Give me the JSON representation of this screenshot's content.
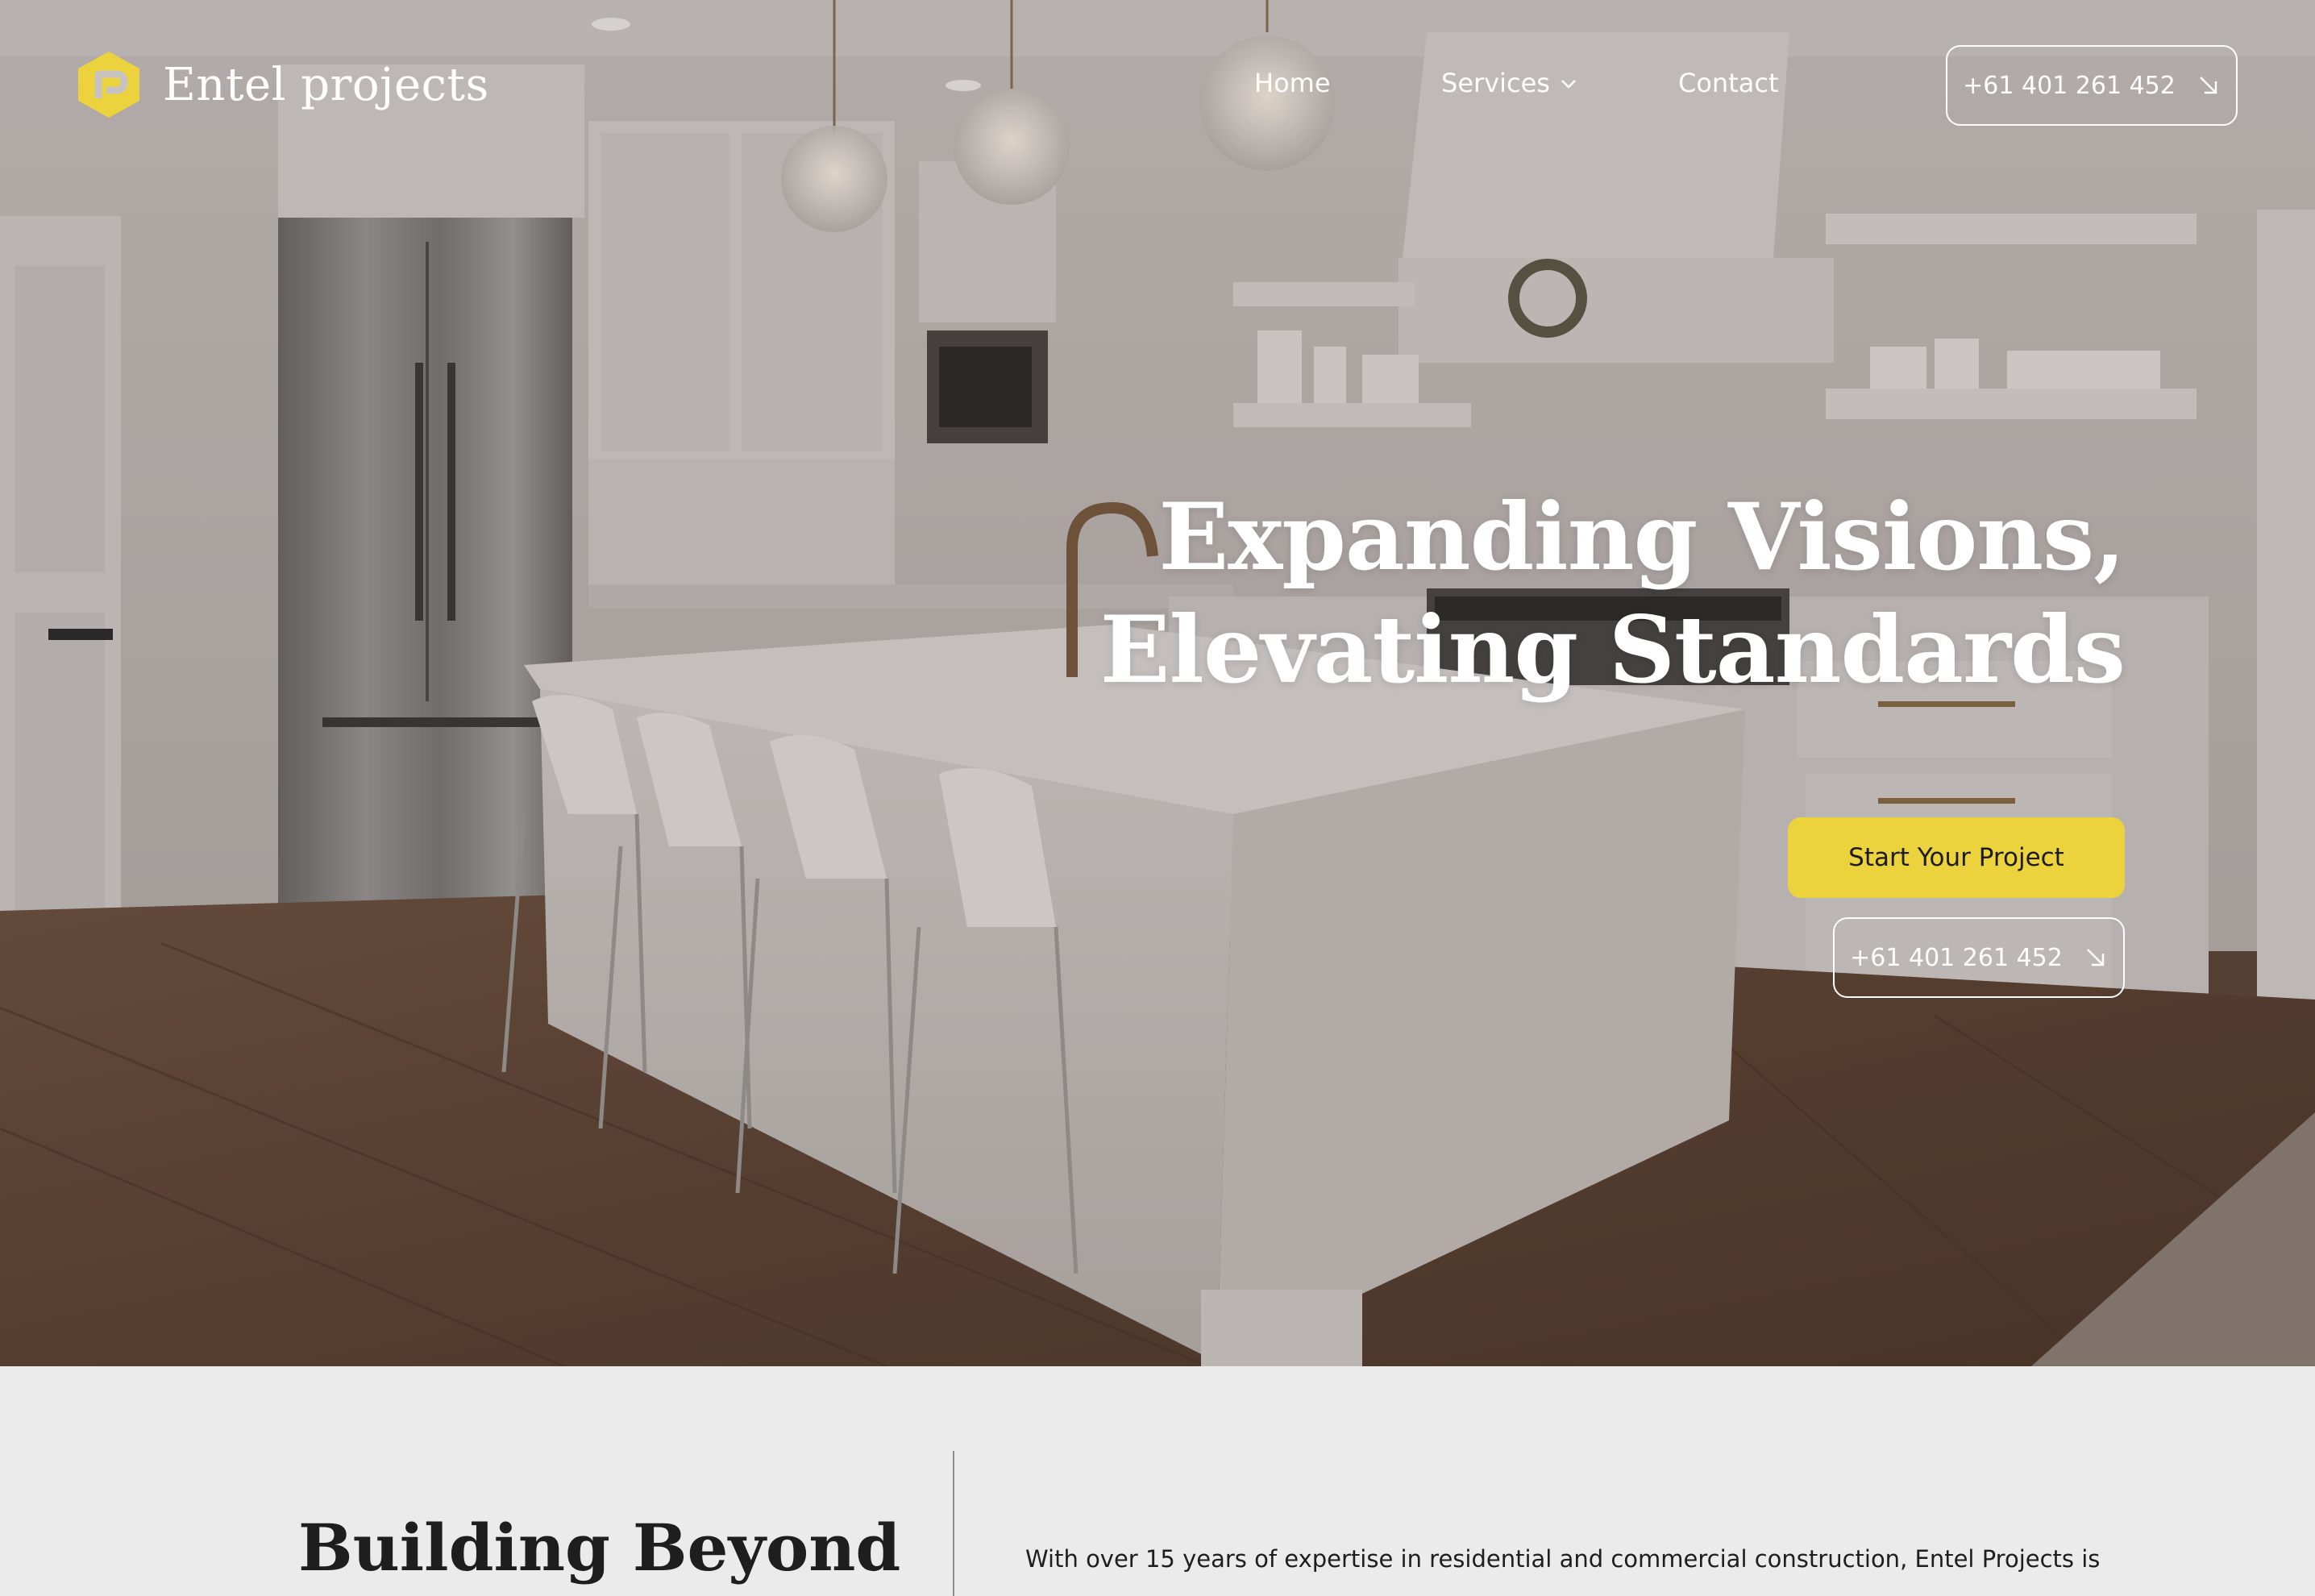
{
  "brand": {
    "name": "Entel projects",
    "accent_color": "#ecd33e",
    "logo_icon": "hexagon-p-logo-icon"
  },
  "nav": {
    "items": [
      {
        "label": "Home"
      },
      {
        "label": "Services",
        "icon": "chevron-down-icon"
      },
      {
        "label": "Contact"
      }
    ],
    "phone_label": "+61 401 261 452",
    "phone_icon": "arrow-down-right-icon"
  },
  "hero": {
    "headline_line1": "Expanding Visions,",
    "headline_line2": "Elevating Standards",
    "cta_label": "Start Your Project",
    "phone_label": "+61 401 261 452",
    "phone_icon": "arrow-down-right-icon",
    "background_image": "kitchen-interior-photo"
  },
  "about": {
    "title": "Building Beyond",
    "text": "With over 15 years of expertise in residential and commercial construction, Entel Projects is"
  }
}
